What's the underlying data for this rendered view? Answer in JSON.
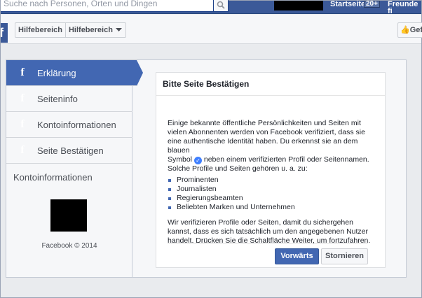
{
  "topbar": {
    "search_placeholder": "Suche nach Personen, Orten und Dingen",
    "home_label": "Startseite",
    "home_badge": "20+",
    "friends_label": "Freunde fi"
  },
  "subbar": {
    "brand_letter": "f",
    "help_label": "Hilfebereich",
    "help_dropdown_label": "Hilfebereich",
    "like_label": "Gef"
  },
  "sidebar": {
    "items": [
      {
        "label": "Erklärung",
        "icon": "facebook-f-icon"
      },
      {
        "label": "Seiteninfo",
        "icon": "facebook-f-icon"
      },
      {
        "label": "Kontoinformationen",
        "icon": "facebook-f-icon"
      },
      {
        "label": "Seite Bestätigen",
        "icon": "facebook-f-icon"
      }
    ],
    "heading": "Kontoinformationen",
    "copyright": "Facebook © 2014"
  },
  "dialog": {
    "title": "Bitte Seite Bestätigen",
    "para1": "Einige bekannte öffentliche Persönlichkeiten und Seiten mit vielen Abonnenten werden von Facebook verifiziert, dass sie eine authentische Identität haben. Du erkennst sie an dem blauen",
    "para1b_before": "Symbol",
    "para1b_after": "neben einem verifizierten Profil oder Seitennamen. Solche Profile und Seiten gehören u. a. zu:",
    "bullets": [
      "Prominenten",
      "Journalisten",
      "Regierungsbeamten",
      "Beliebten Marken und Unternehmen"
    ],
    "para2": "Wir verifizieren Profile oder Seiten, damit du sichergehen kannst, dass es sich tatsächlich um den angegebenen Nutzer handelt. Drücken Sie die Schaltfläche Weiter, um fortzufahren.",
    "confirm_label": "Vorwärts",
    "cancel_label": "Stornieren"
  },
  "colors": {
    "brand_blue": "#3b5998",
    "active_nav": "#4267b2",
    "verified_badge": "#4080ff"
  }
}
